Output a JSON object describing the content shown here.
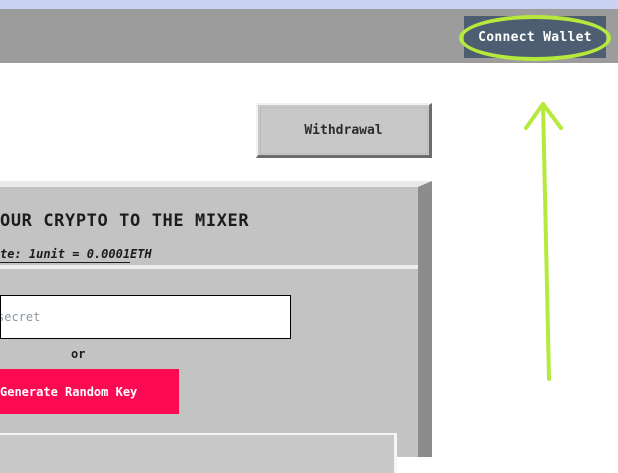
{
  "header": {
    "connect_wallet_label": "Connect Wallet",
    "accent_color": "#4e5e72",
    "highlight_color": "#b5ea3c"
  },
  "main": {
    "withdraw_label": "Withdrawal"
  },
  "mixer_panel": {
    "title": "OUR CRYPTO TO THE MIXER",
    "rate_text": "te: 1unit = 0.0001ETH",
    "secret_placeholder": "secret",
    "or_label": "or",
    "generate_label": "Generate Random Key",
    "generate_color": "#fb0a52"
  },
  "annotation": {
    "arrow_icon": "up-arrow-icon"
  }
}
